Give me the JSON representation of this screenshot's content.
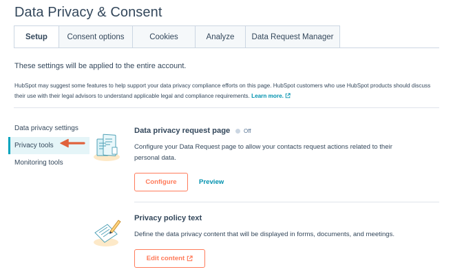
{
  "page": {
    "title": "Data Privacy & Consent"
  },
  "tabs": [
    {
      "label": "Setup",
      "active": true
    },
    {
      "label": "Consent options",
      "active": false
    },
    {
      "label": "Cookies",
      "active": false
    },
    {
      "label": "Analyze",
      "active": false
    },
    {
      "label": "Data Request Manager",
      "active": false
    }
  ],
  "intro": "These settings will be applied to the entire account.",
  "disclaimer": {
    "text": "HubSpot may suggest some features to help support your data privacy compliance efforts on this page. HubSpot customers who use HubSpot products should discuss their use with their legal advisors to understand applicable legal and compliance requirements.",
    "link_label": "Learn more.",
    "link_icon": "external-link-icon"
  },
  "sidebar": {
    "items": [
      {
        "label": "Data privacy settings",
        "active": false
      },
      {
        "label": "Privacy tools",
        "active": true
      },
      {
        "label": "Monitoring tools",
        "active": false
      }
    ]
  },
  "cards": {
    "request_page": {
      "title": "Data privacy request page",
      "status": "Off",
      "description": "Configure your Data Request page to allow your contacts request actions related to their personal data.",
      "primary_label": "Configure",
      "secondary_label": "Preview",
      "icon": "request-page-illustration"
    },
    "policy_text": {
      "title": "Privacy policy text",
      "description": "Define the data privacy content that will be displayed in forms, documents, and meetings.",
      "button_label": "Edit content",
      "button_icon": "external-link-icon",
      "icon": "policy-document-illustration"
    }
  },
  "colors": {
    "accent_orange": "#ff7a59",
    "link_teal": "#0091ae",
    "active_nav_bg": "#e5f5f8",
    "text": "#33475b",
    "annotation_arrow": "#e0623c"
  }
}
